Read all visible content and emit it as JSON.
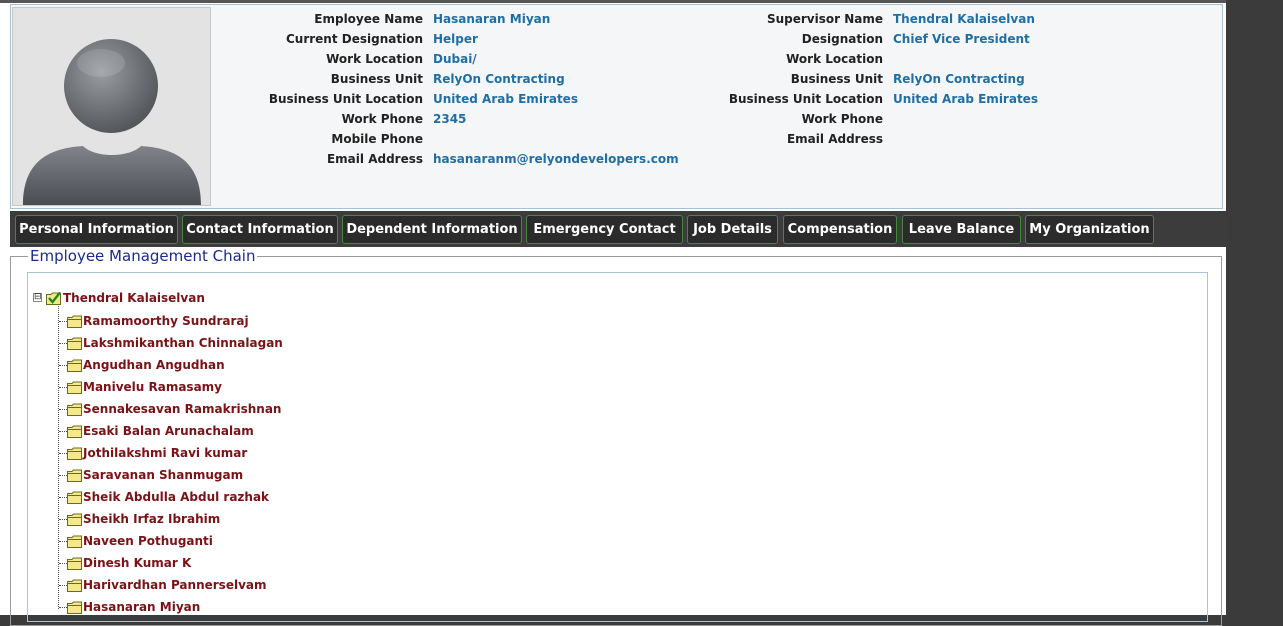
{
  "profile": {
    "left_fields": [
      {
        "label": "Employee Name",
        "value": "Hasanaran Miyan"
      },
      {
        "label": "Current Designation",
        "value": "Helper"
      },
      {
        "label": "Work Location",
        "value": "Dubai/"
      },
      {
        "label": "Business Unit",
        "value": "RelyOn Contracting"
      },
      {
        "label": "Business Unit Location",
        "value": "United Arab Emirates"
      },
      {
        "label": "Work Phone",
        "value": "2345"
      },
      {
        "label": "Mobile Phone",
        "value": ""
      },
      {
        "label": "Email Address",
        "value": "hasanaranm@relyondevelopers.com"
      }
    ],
    "right_fields": [
      {
        "label": "Supervisor Name",
        "value": "Thendral Kalaiselvan"
      },
      {
        "label": "Designation",
        "value": "Chief Vice President"
      },
      {
        "label": "Work Location",
        "value": ""
      },
      {
        "label": "Business Unit",
        "value": "RelyOn Contracting"
      },
      {
        "label": "Business Unit Location",
        "value": "United Arab Emirates"
      },
      {
        "label": "Work Phone",
        "value": ""
      },
      {
        "label": "Email Address",
        "value": ""
      }
    ],
    "photo_icon": "user-avatar-placeholder-icon"
  },
  "tabs": [
    {
      "label": "Personal Information"
    },
    {
      "label": "Contact Information"
    },
    {
      "label": "Dependent Information"
    },
    {
      "label": "Emergency Contact"
    },
    {
      "label": "Job Details"
    },
    {
      "label": "Compensation"
    },
    {
      "label": "Leave Balance"
    },
    {
      "label": "My Organization"
    }
  ],
  "chain": {
    "title": "Employee Management Chain",
    "root": {
      "name": "Thendral Kalaiselvan",
      "icon": "checked-folder-icon",
      "expander": "⊟"
    },
    "children": [
      "Ramamoorthy Sundraraj",
      "Lakshmikanthan Chinnalagan",
      "Angudhan Angudhan",
      "Manivelu Ramasamy",
      "Sennakesavan Ramakrishnan",
      "Esaki Balan Arunachalam",
      "Jothilakshmi Ravi kumar",
      "Saravanan Shanmugam",
      "Sheik Abdulla Abdul razhak",
      "Sheikh Irfaz Ibrahim",
      "Naveen Pothuganti",
      "Dinesh Kumar K",
      "Harivardhan Pannerselvam",
      "Hasanaran Miyan"
    ],
    "child_icon": "folder-icon"
  },
  "colors": {
    "value_text": "#1f6fa6",
    "tree_text": "#7b1216",
    "tab_border": "#3f8b3a",
    "legend_text": "#1a2a8f"
  }
}
